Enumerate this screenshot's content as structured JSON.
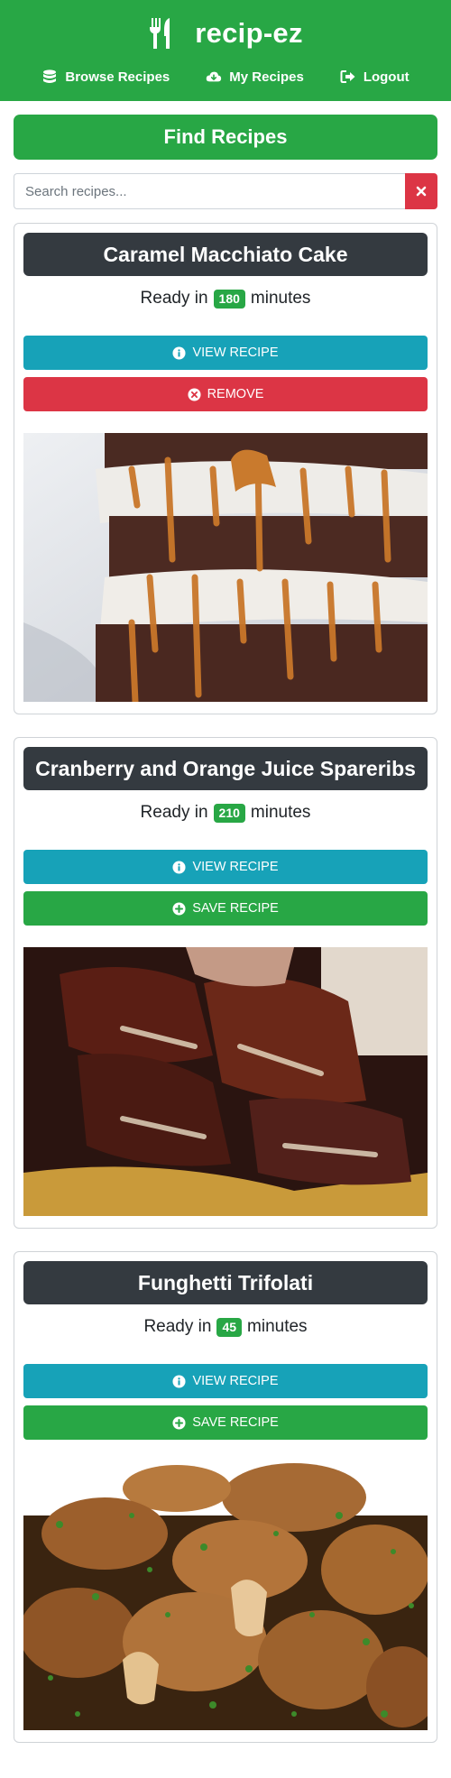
{
  "app": {
    "brand": "recip-ez",
    "brand_icon": "utensils-icon"
  },
  "nav": [
    {
      "label": "Browse Recipes",
      "icon": "database-icon"
    },
    {
      "label": "My Recipes",
      "icon": "cloud-download-icon"
    },
    {
      "label": "Logout",
      "icon": "sign-out-icon"
    }
  ],
  "find_label": "Find Recipes",
  "search": {
    "placeholder": "Search recipes...",
    "value": ""
  },
  "recipes": [
    {
      "title": "Caramel Macchiato Cake",
      "ready_prefix": "Ready in",
      "minutes": "180",
      "ready_suffix": "minutes",
      "view_label": "VIEW RECIPE",
      "action_label": "REMOVE",
      "action_icon": "times-circle-icon"
    },
    {
      "title": "Cranberry and Orange Juice Spareribs",
      "ready_prefix": "Ready in",
      "minutes": "210",
      "ready_suffix": "minutes",
      "view_label": "VIEW RECIPE",
      "action_label": "SAVE RECIPE",
      "action_icon": "plus-circle-icon"
    },
    {
      "title": "Funghetti Trifolati",
      "ready_prefix": "Ready in",
      "minutes": "45",
      "ready_suffix": "minutes",
      "view_label": "VIEW RECIPE",
      "action_label": "SAVE RECIPE",
      "action_icon": "plus-circle-icon"
    }
  ],
  "colors": {
    "primary": "#28a745",
    "info": "#17a2b8",
    "danger": "#dc3545",
    "dark": "#343a40"
  }
}
